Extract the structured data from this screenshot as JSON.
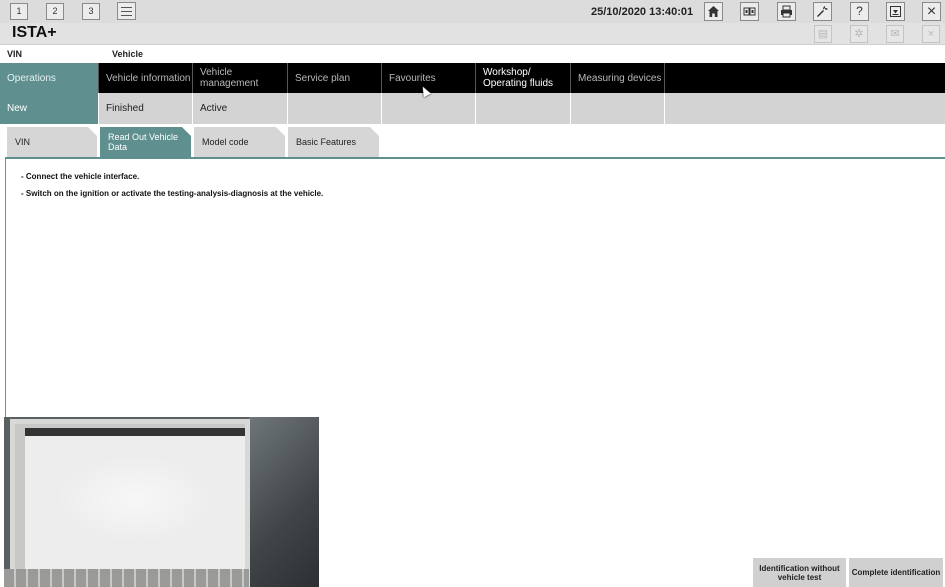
{
  "toolbar": {
    "num_buttons": [
      "1",
      "2",
      "3"
    ],
    "datetime": "25/10/2020 13:40:01",
    "icons": [
      "home-icon",
      "pair-icon",
      "printer-icon",
      "wrench-icon",
      "help-icon",
      "download-icon",
      "close-icon"
    ],
    "help_glyph": "?",
    "close_glyph": "×"
  },
  "titlebar": {
    "title": "ISTA+",
    "ghost_icons": [
      "copy-icon",
      "gear-icon",
      "mail-icon",
      "close-icon"
    ]
  },
  "labels": {
    "vin": "VIN",
    "vehicle": "Vehicle"
  },
  "main_nav": [
    {
      "label": "Operations",
      "active": true
    },
    {
      "label": "Vehicle information"
    },
    {
      "label": "Vehicle management"
    },
    {
      "label": "Service plan"
    },
    {
      "label": "Favourites"
    },
    {
      "label": "Workshop/ Operating fluids"
    },
    {
      "label": "Measuring devices"
    }
  ],
  "sub_nav": [
    {
      "label": "New",
      "active": true
    },
    {
      "label": "Finished"
    },
    {
      "label": "Active"
    },
    {
      "label": ""
    },
    {
      "label": ""
    },
    {
      "label": ""
    },
    {
      "label": ""
    }
  ],
  "folder_tabs": [
    {
      "label": "VIN"
    },
    {
      "label": "Read Out Vehicle Data",
      "active": true
    },
    {
      "label": "Model code"
    },
    {
      "label": "Basic Features"
    }
  ],
  "messages": [
    "- Connect the vehicle interface.",
    "- Switch on the ignition or activate the testing-analysis-diagnosis at the vehicle."
  ],
  "bottom_buttons": {
    "identification_no_test": "Identification without vehicle test",
    "complete_identification": "Complete identification"
  },
  "colors": {
    "accent": "#5f8f8e",
    "nav_bg": "#000000",
    "subnav_bg": "#d3d3d3",
    "toolbar_bg": "#dcdcdc"
  }
}
